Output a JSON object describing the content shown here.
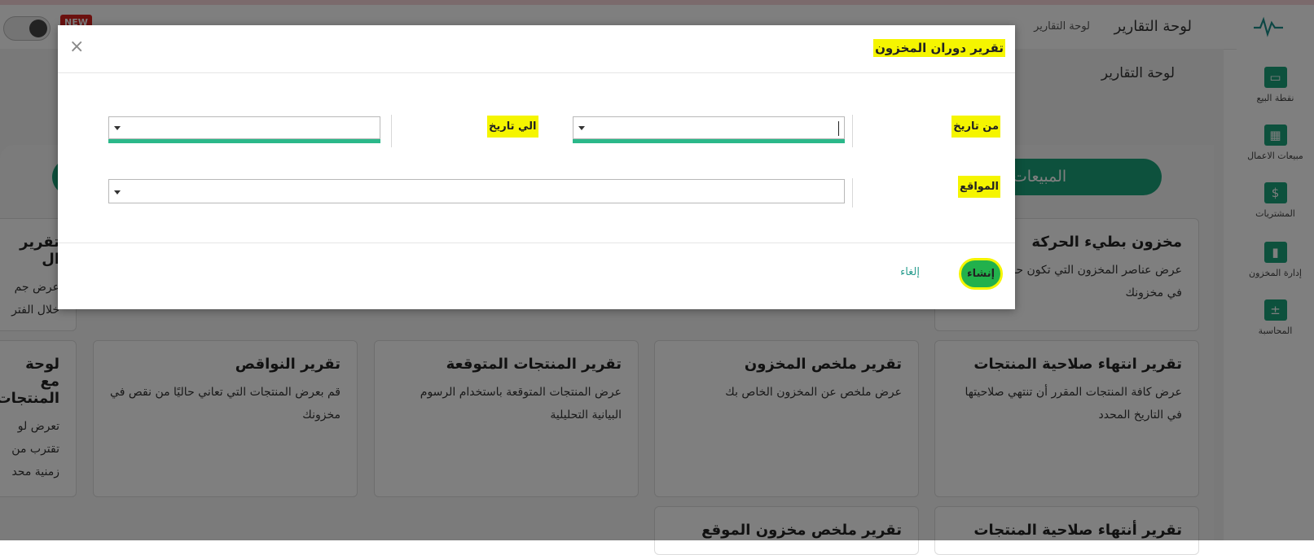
{
  "header": {
    "app_title": "لوحة التقارير",
    "breadcrumb": "لوحة التقارير",
    "new_badge": "NEW"
  },
  "sidebar": {
    "items": [
      {
        "label": "نقطة البيع",
        "icon": "pos-monitor-icon"
      },
      {
        "label": "مبيعات الاعمال",
        "icon": "calculator-icon"
      },
      {
        "label": "المشتريات",
        "icon": "dollar-icon"
      },
      {
        "label": "إدارة المخزون",
        "icon": "inventory-box-icon"
      },
      {
        "label": "المحاسبة",
        "icon": "accounting-icon"
      }
    ]
  },
  "main": {
    "title": "لوحة التقارير",
    "tab_sales": "المبيعات",
    "cards": [
      {
        "title": "مخزون بطيء الحركة",
        "desc": "عرض عناصر المخزون التي تكون حركة بطيئة في مخزونك"
      },
      {
        "title": "تقرير ال",
        "desc": "عرض جم خلال الفتر"
      },
      {
        "title": "تقرير انتهاء صلاحية المنتجات",
        "desc": "عرض كافة المنتجات المقرر أن تنتهي صلاحيتها في التاريخ المحدد"
      },
      {
        "title": "تقرير ملخص المخزون",
        "desc": "عرض ملخص عن المخزون الخاص بك"
      },
      {
        "title": "تقرير المنتجات المتوقعة",
        "desc": "عرض المنتجات المتوقعة باستخدام الرسوم البيانية التحليلية"
      },
      {
        "title": "تقرير النواقص",
        "desc": "قم بعرض المنتجات التي تعاني حاليًا من نقص في مخزونك"
      },
      {
        "title": "لوحة مع المنتجات",
        "desc": "تعرض لو تقترب من زمنية محد"
      },
      {
        "title": "تقرير أنتهاء صلاحية المنتجات",
        "desc": ""
      },
      {
        "title": "تقرير ملخص مخزون الموقع",
        "desc": ""
      }
    ]
  },
  "modal": {
    "title": "تقرير دوران المخزون",
    "close_label": "×",
    "from_date_label": "من تاريخ",
    "to_date_label": "الي تاريخ",
    "locations_label": "المواقع",
    "from_date_value": "",
    "to_date_value": "",
    "locations_value": "",
    "create_button": "إنشاء",
    "cancel_button": "إلغاء"
  },
  "colors": {
    "accent": "#1ba37a",
    "highlight": "#f5f500",
    "create_button": "#22b14c",
    "field_underline": "#2bb88a"
  }
}
